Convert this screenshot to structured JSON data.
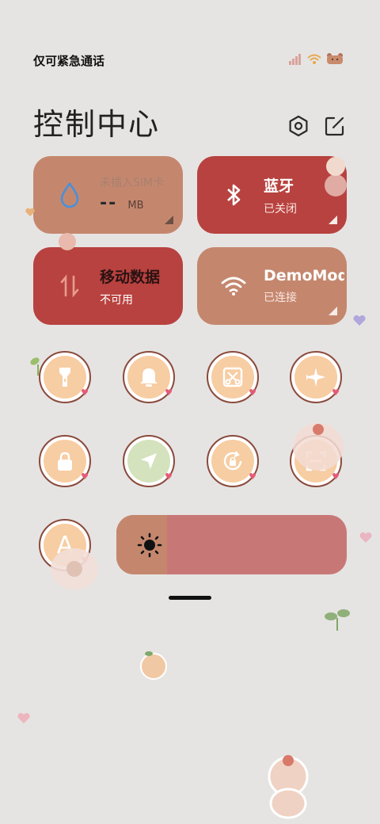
{
  "status": {
    "carrier_text": "仅可紧急通话"
  },
  "header": {
    "title": "控制中心"
  },
  "tiles": [
    {
      "title": "未插入SIM卡",
      "value": "--",
      "unit": "MB"
    },
    {
      "title": "蓝牙",
      "subtitle": "已关闭"
    },
    {
      "title": "移动数据",
      "subtitle": "不可用"
    },
    {
      "title": "DemoMode",
      "subtitle": "已连接"
    }
  ],
  "toggles": [
    {
      "icon": "flashlight-icon"
    },
    {
      "icon": "bell-icon"
    },
    {
      "icon": "screenshot-icon"
    },
    {
      "icon": "airplane-icon"
    },
    {
      "icon": "lock-icon"
    },
    {
      "icon": "location-icon"
    },
    {
      "icon": "rotation-lock-icon"
    },
    {
      "icon": "scanner-icon"
    },
    {
      "icon": "auto-text-icon",
      "label": "A"
    }
  ],
  "brightness": {
    "level": 0.22
  },
  "colors": {
    "tile_tan": "#c4876e",
    "tile_red": "#b8423f",
    "toggle_fill": "#f7cda3",
    "background": "#e6e4e3"
  }
}
